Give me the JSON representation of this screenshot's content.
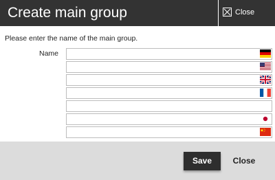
{
  "dialog": {
    "title": "Create main group",
    "close_label": "Close"
  },
  "form": {
    "instruction": "Please enter the name of the main group.",
    "name_label": "Name",
    "fields": [
      {
        "language": "German",
        "flag": "flag-de-icon",
        "value": ""
      },
      {
        "language": "English (US)",
        "flag": "flag-us-icon",
        "value": ""
      },
      {
        "language": "English (UK)",
        "flag": "flag-gb-icon",
        "value": ""
      },
      {
        "language": "French",
        "flag": "flag-fr-icon",
        "value": ""
      },
      {
        "language": "",
        "flag": "",
        "value": ""
      },
      {
        "language": "Japanese",
        "flag": "flag-jp-icon",
        "value": ""
      },
      {
        "language": "Chinese",
        "flag": "flag-cn-icon",
        "value": ""
      }
    ]
  },
  "footer": {
    "save_label": "Save",
    "close_label": "Close"
  },
  "colors": {
    "titlebar": "#333333",
    "footer": "#dcdcdc",
    "save_button": "#2e2e2e"
  }
}
